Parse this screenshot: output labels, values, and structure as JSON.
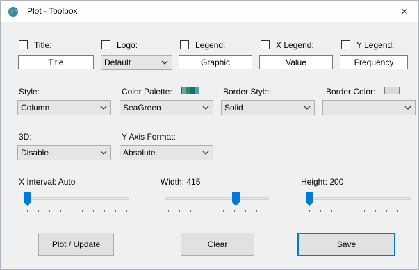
{
  "window": {
    "title": "Plot - Toolbox",
    "close_glyph": "×"
  },
  "options_row": [
    {
      "id": "title",
      "label": "Title:",
      "value": "Title"
    },
    {
      "id": "logo",
      "label": "Logo:",
      "value": "Default"
    },
    {
      "id": "legend",
      "label": "Legend:",
      "value": "Graphic"
    },
    {
      "id": "xlegend",
      "label": "X Legend:",
      "value": "Value"
    },
    {
      "id": "ylegend",
      "label": "Y Legend:",
      "value": "Frequency"
    }
  ],
  "style": {
    "label": "Style:",
    "value": "Column"
  },
  "palette": {
    "label": "Color Palette:",
    "value": "SeaGreen",
    "swatch_colors": [
      "#5fa8a8",
      "#2e8b57",
      "#1b6f6f",
      "#4d9fb4"
    ]
  },
  "border_style": {
    "label": "Border Style:",
    "value": "Solid"
  },
  "border_color": {
    "label": "Border Color:",
    "value": "",
    "swatch_color": "#d9d9d9"
  },
  "three_d": {
    "label": "3D:",
    "value": "Disable"
  },
  "y_axis_format": {
    "label": "Y Axis Format:",
    "value": "Absolute"
  },
  "sliders": {
    "x_interval": {
      "label": "X Interval: Auto",
      "position": 0.0,
      "tick_count": 10
    },
    "width": {
      "label": "Width: 415",
      "position": 0.69,
      "tick_count": 10
    },
    "height": {
      "label": "Height: 200",
      "position": 0.0,
      "tick_count": 10
    }
  },
  "buttons": {
    "plot": "Plot / Update",
    "clear": "Clear",
    "save": "Save"
  },
  "colors": {
    "accent": "#0078d7",
    "thumb": "#0078d7"
  }
}
